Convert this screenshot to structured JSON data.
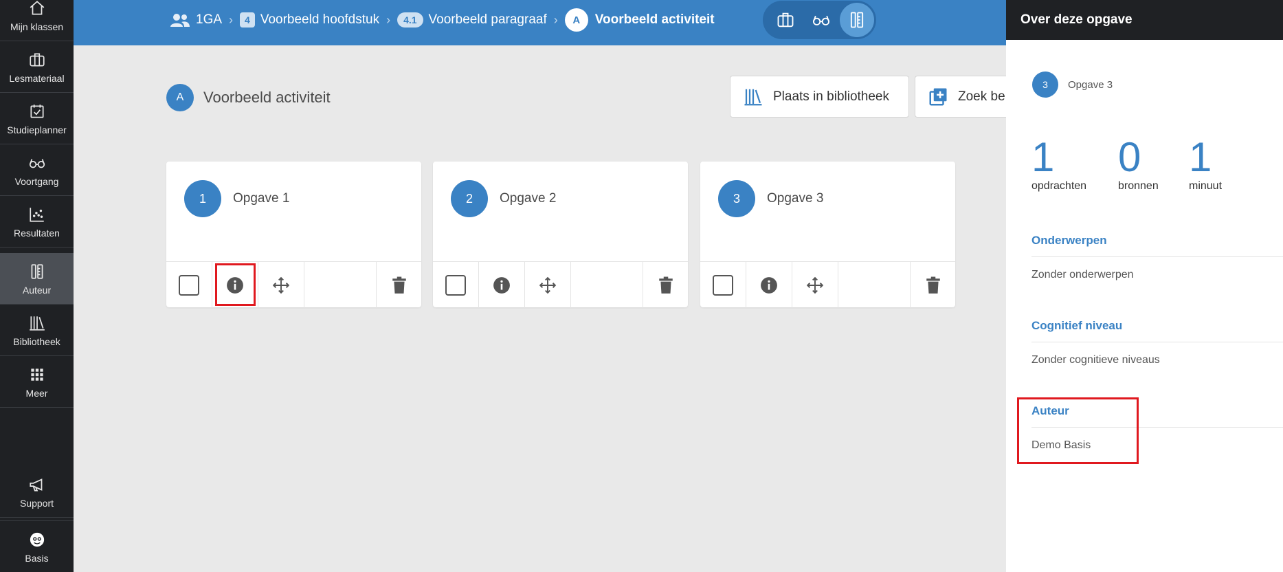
{
  "sidebar": {
    "items": [
      {
        "label": "Mijn klassen",
        "icon": "home-icon"
      },
      {
        "label": "Lesmateriaal",
        "icon": "briefcase-icon"
      },
      {
        "label": "Studieplanner",
        "icon": "calendar-check-icon"
      },
      {
        "label": "Voortgang",
        "icon": "glasses-icon"
      },
      {
        "label": "Resultaten",
        "icon": "scatter-chart-icon"
      },
      {
        "label": "Auteur",
        "icon": "author-tools-icon",
        "active": true
      },
      {
        "label": "Bibliotheek",
        "icon": "library-icon"
      },
      {
        "label": "Meer",
        "icon": "grid-icon"
      },
      {
        "label": "Support",
        "icon": "megaphone-icon"
      },
      {
        "label": "Basis",
        "icon": "avatar-icon"
      }
    ]
  },
  "breadcrumb": {
    "class_name": "1GA",
    "chapter_badge": "4",
    "chapter": "Voorbeeld hoofdstuk",
    "paragraph_badge": "4.1",
    "paragraph": "Voorbeeld paragraaf",
    "activity_badge": "A",
    "activity": "Voorbeeld activiteit"
  },
  "page": {
    "badge": "A",
    "title": "Voorbeeld activiteit",
    "library_button": "Plaats in bibliotheek",
    "search_button": "Zoek be"
  },
  "cards": [
    {
      "number": "1",
      "title": "Opgave 1"
    },
    {
      "number": "2",
      "title": "Opgave 2"
    },
    {
      "number": "3",
      "title": "Opgave 3"
    }
  ],
  "panel": {
    "title": "Over deze opgave",
    "opgave_number": "3",
    "opgave_label": "Opgave 3",
    "stats": [
      {
        "value": "1",
        "label": "opdrachten"
      },
      {
        "value": "0",
        "label": "bronnen"
      },
      {
        "value": "1",
        "label": "minuut"
      }
    ],
    "sections": [
      {
        "title": "Onderwerpen",
        "text": "Zonder onderwerpen"
      },
      {
        "title": "Cognitief niveau",
        "text": "Zonder cognitieve niveaus"
      },
      {
        "title": "Auteur",
        "text": "Demo Basis"
      }
    ]
  },
  "colors": {
    "primary": "#3a82c4",
    "sidebar": "#1f2124",
    "highlight": "#e0191f"
  }
}
